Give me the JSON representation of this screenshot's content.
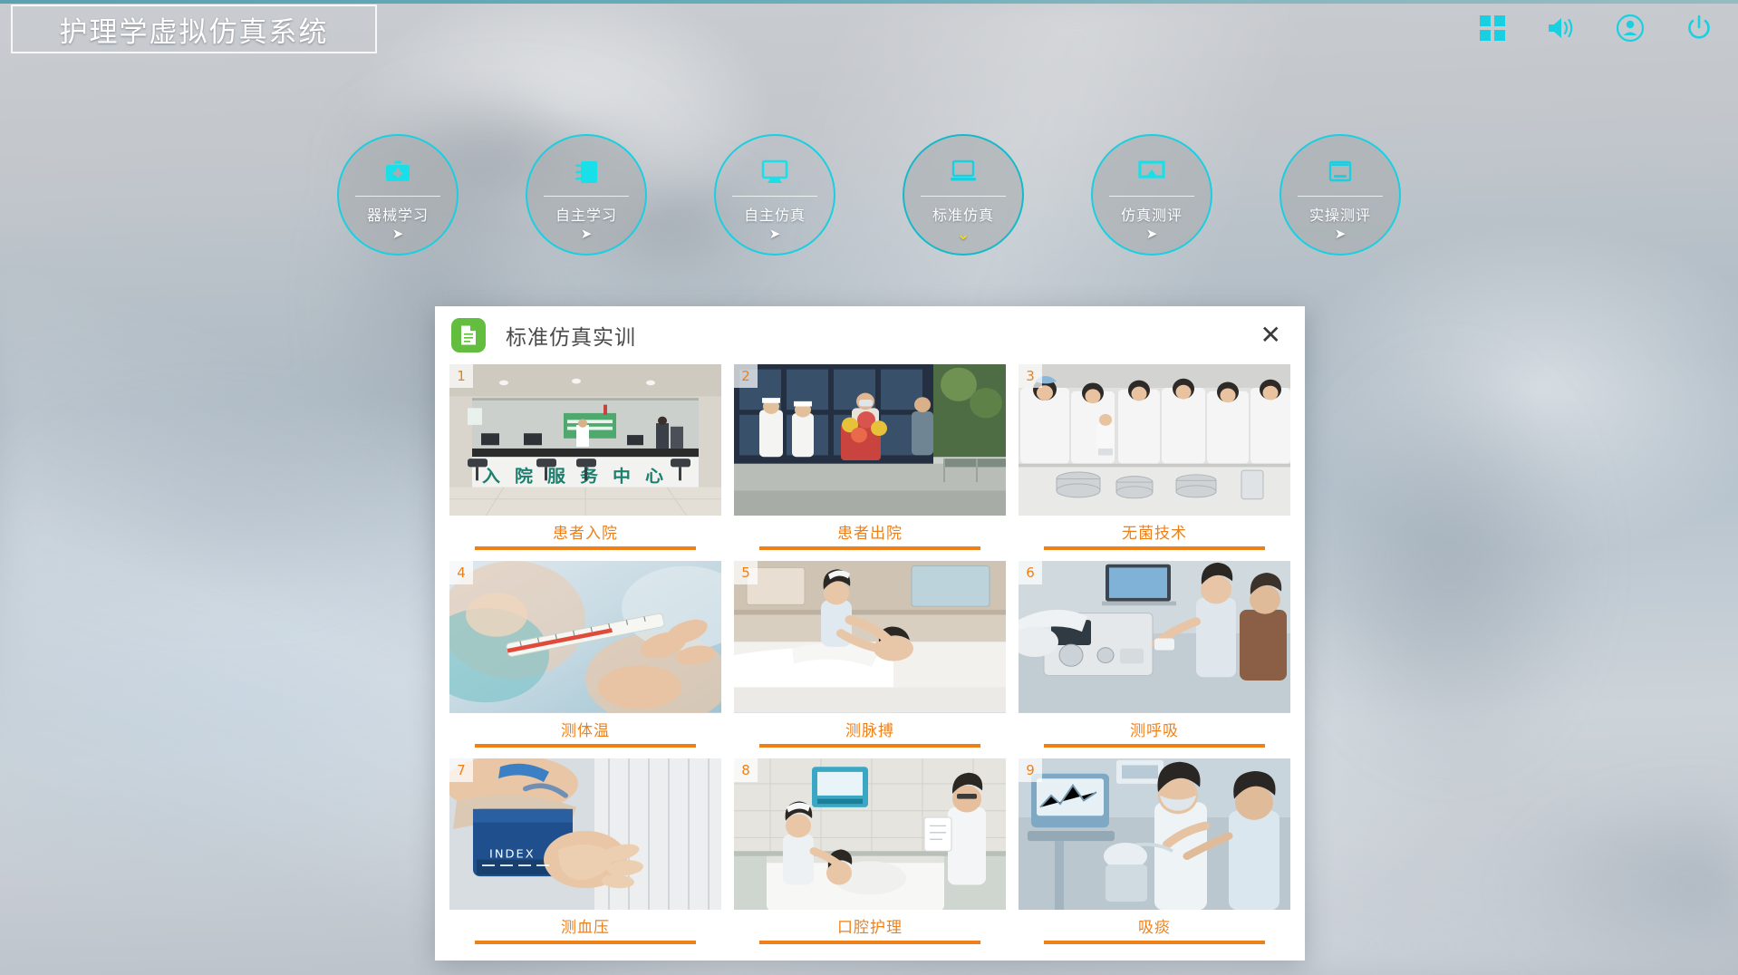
{
  "app": {
    "title": "护理学虚拟仿真系统",
    "accent_cyan": "#19cfe0",
    "accent_teal": "#16b9c9",
    "accent_orange": "#ef8018",
    "accent_green": "#63bd3f",
    "accent_yellow": "#ffe400"
  },
  "topbar": {
    "icons": [
      {
        "name": "grid-icon",
        "glyph": "grid"
      },
      {
        "name": "volume-icon",
        "glyph": "volume"
      },
      {
        "name": "user-icon",
        "glyph": "user"
      },
      {
        "name": "power-icon",
        "glyph": "power"
      }
    ]
  },
  "nav": {
    "items": [
      {
        "label": "器械学习",
        "icon": "medical-kit-icon",
        "arrow": "➤",
        "state": "normal"
      },
      {
        "label": "自主学习",
        "icon": "notebook-icon",
        "arrow": "➤",
        "state": "normal"
      },
      {
        "label": "自主仿真",
        "icon": "monitor-icon",
        "arrow": "➤",
        "state": "transparent"
      },
      {
        "label": "标准仿真",
        "icon": "laptop-screen-icon",
        "arrow": "⌄",
        "state": "active"
      },
      {
        "label": "仿真测评",
        "icon": "screencast-icon",
        "arrow": "➤",
        "state": "normal"
      },
      {
        "label": "实操测评",
        "icon": "laptop-icon",
        "arrow": "➤",
        "state": "normal"
      }
    ]
  },
  "modal": {
    "title": "标准仿真实训",
    "icon": "document-icon",
    "close_label": "✕",
    "cards": [
      {
        "num": "1",
        "label": "患者入院",
        "scene": "admission-desk"
      },
      {
        "num": "2",
        "label": "患者出院",
        "scene": "discharge"
      },
      {
        "num": "3",
        "label": "无菌技术",
        "scene": "aseptic"
      },
      {
        "num": "4",
        "label": "测体温",
        "scene": "thermometer"
      },
      {
        "num": "5",
        "label": "测脉搏",
        "scene": "pulse"
      },
      {
        "num": "6",
        "label": "测呼吸",
        "scene": "respiration"
      },
      {
        "num": "7",
        "label": "测血压",
        "scene": "bloodpressure"
      },
      {
        "num": "8",
        "label": "口腔护理",
        "scene": "oralcare"
      },
      {
        "num": "9",
        "label": "吸痰",
        "scene": "suction"
      }
    ]
  }
}
